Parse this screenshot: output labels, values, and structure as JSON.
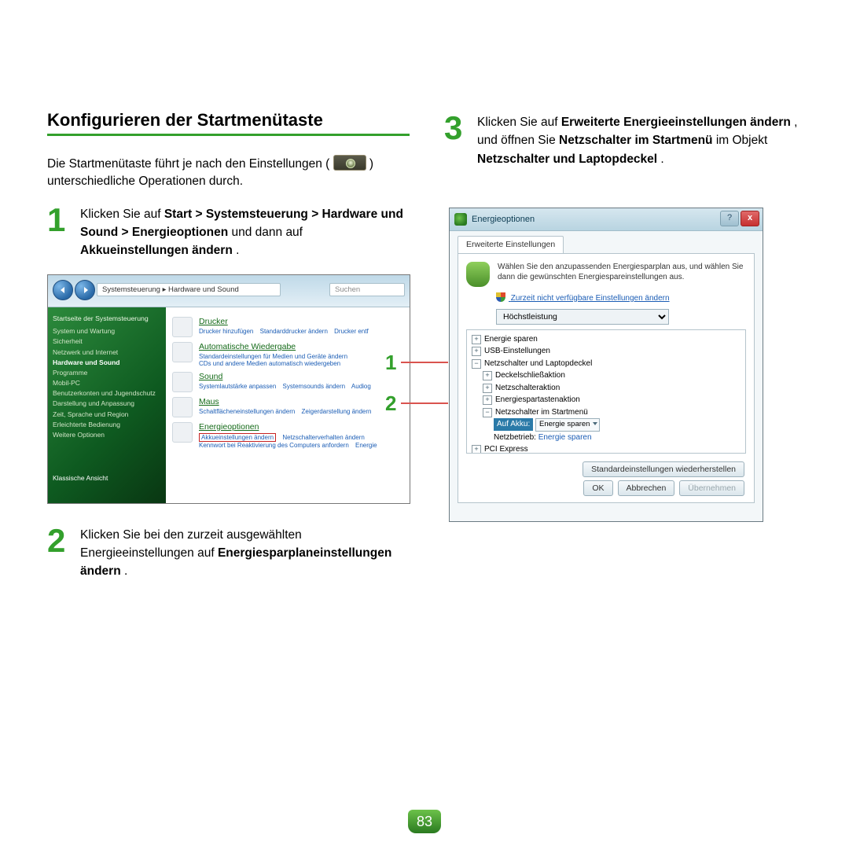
{
  "section_title": "Konfigurieren der Startmenütaste",
  "intro_before_icon": "Die Startmenütaste führt je nach den Einstellungen (",
  "intro_after_icon": ") unterschiedliche Operationen durch.",
  "step1": {
    "num": "1",
    "html_parts": [
      "Klicken Sie auf ",
      "Start > Systemsteuerung > Hardware und Sound > Energieoptionen",
      " und dann auf ",
      "Akkueinstellungen ändern",
      "."
    ]
  },
  "step2": {
    "num": "2",
    "html_parts": [
      "Klicken Sie bei den zurzeit ausgewählten Energieeinstellungen auf ",
      "Energiesparplaneinstellungen ändern",
      "."
    ]
  },
  "step3": {
    "num": "3",
    "html_parts": [
      "Klicken Sie auf ",
      "Erweiterte Energieeinstellungen ändern",
      ", und öffnen Sie ",
      "Netzschalter im Startmenü",
      " im Objekt ",
      "Netzschalter und Laptopdeckel",
      "."
    ]
  },
  "callout_1": "1",
  "callout_2": "2",
  "cp": {
    "breadcrumb": "Systemsteuerung  ▸  Hardware und Sound",
    "search": "Suchen",
    "sidebar_home": "Startseite der Systemsteuerung",
    "sidebar": [
      "System und Wartung",
      "Sicherheit",
      "Netzwerk und Internet",
      "Hardware und Sound",
      "Programme",
      "Mobil-PC",
      "Benutzerkonten und Jugendschutz",
      "Darstellung und Anpassung",
      "Zeit, Sprache und Region",
      "Erleichterte Bedienung",
      "Weitere Optionen"
    ],
    "klassische": "Klassische Ansicht",
    "items": [
      {
        "title": "Drucker",
        "subs": [
          "Drucker hinzufügen",
          "Standarddrucker ändern",
          "Drucker entf"
        ]
      },
      {
        "title": "Automatische Wiedergabe",
        "subs": [
          "Standardeinstellungen für Medien und Geräte ändern",
          "CDs und andere Medien automatisch wiedergeben"
        ]
      },
      {
        "title": "Sound",
        "subs": [
          "Systemlautstärke anpassen",
          "Systemsounds ändern",
          "Audiog"
        ]
      },
      {
        "title": "Maus",
        "subs": [
          "Schaltflächeneinstellungen ändern",
          "Zeigerdarstellung ändern"
        ]
      },
      {
        "title": "Energieoptionen",
        "subs_red": "Akkueinstellungen ändern",
        "subs_rest": [
          "Netzschalterverhalten ändern",
          "Kennwort bei Reaktivierung des Computers anfordern",
          "Energie"
        ]
      }
    ]
  },
  "dlg": {
    "title": "Energieoptionen",
    "tab": "Erweiterte Einstellungen",
    "desc": "Wählen Sie den anzupassenden Energiesparplan aus, und wählen Sie dann die gewünschten Energiespareinstellungen aus.",
    "link": "Zurzeit nicht verfügbare Einstellungen ändern",
    "plan": "Höchstleistung",
    "tree": {
      "n0": "Energie sparen",
      "n1": "USB-Einstellungen",
      "n2": "Netzschalter und Laptopdeckel",
      "n2a": "Deckelschließaktion",
      "n2b": "Netzschalteraktion",
      "n2c": "Energiespartastenaktion",
      "n2d": "Netzschalter im Startmenü",
      "n2d_sel_label": "Auf Akku:",
      "n2d_sel_value": "Energie sparen",
      "n2d_net_label": "Netzbetrieb:",
      "n2d_net_value": "Energie sparen",
      "n3": "PCI Express"
    },
    "restore": "Standardeinstellungen wiederherstellen",
    "ok": "OK",
    "cancel": "Abbrechen",
    "apply": "Übernehmen",
    "help": "?",
    "close": "x"
  },
  "page_number": "83"
}
